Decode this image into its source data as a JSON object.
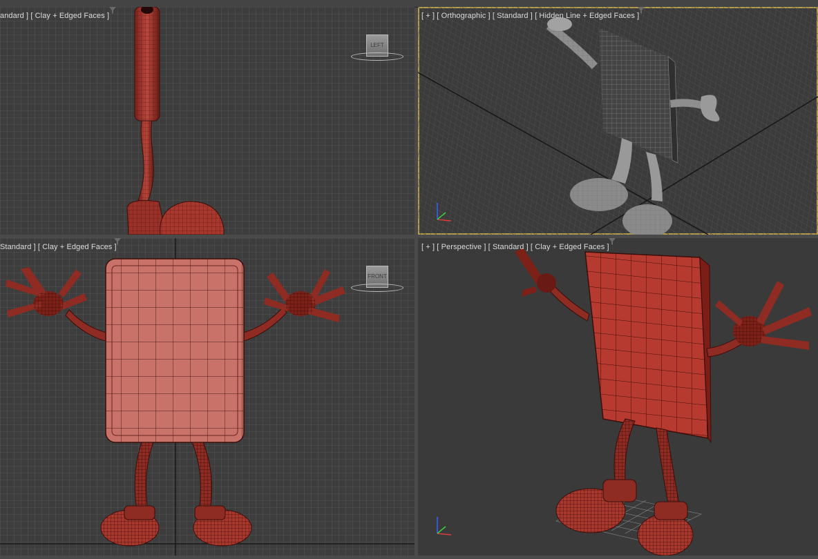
{
  "app": {
    "name": "3ds Max viewport layout"
  },
  "viewports": {
    "top_left": {
      "label": "andard ] [ Clay + Edged Faces ]",
      "nav_cube_face": "LEFT"
    },
    "top_right": {
      "label": "[ + ] [ Orthographic ] [ Standard ] [ Hidden Line + Edged Faces ]"
    },
    "bottom_left": {
      "label": "Standard ] [ Clay + Edged Faces ]",
      "nav_cube_face": "FRONT"
    },
    "bottom_right": {
      "label": "[ + ] [ Perspective ] [ Standard ] [ Clay + Edged Faces ]"
    }
  },
  "colors": {
    "viewport_bg": "#3d3d3d",
    "grid_line": "#555555",
    "active_border": "#b79d4b",
    "clay": "#a8382e",
    "clay_dark": "#5a1712",
    "clay_light": "#c96a62",
    "hidden_line": "#9d9d9d"
  },
  "icons": [
    "filter-icon",
    "view-cube",
    "axis-gizmo"
  ]
}
